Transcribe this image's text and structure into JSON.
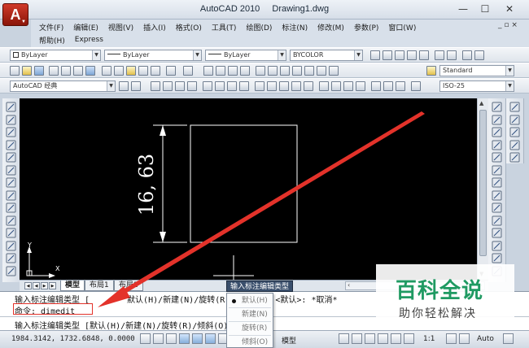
{
  "title": {
    "app": "AutoCAD 2010",
    "document": "Drawing1.dwg"
  },
  "app_button_label": "A",
  "window_controls": {
    "minimize": "—",
    "maximize": "☐",
    "close": "✕"
  },
  "menu": {
    "row1": [
      "文件(F)",
      "编辑(E)",
      "视图(V)",
      "插入(I)",
      "格式(O)",
      "工具(T)",
      "绘图(D)",
      "标注(N)",
      "修改(M)",
      "参数(P)",
      "窗口(W)"
    ],
    "row2": [
      "帮助(H)",
      "Express"
    ],
    "doc_controls": "_ ▫ ×"
  },
  "toolbar": {
    "layer_combo": "ByLayer",
    "linetype_combo": "ByLayer",
    "lineweight_combo": "ByLayer",
    "color_combo": "BYCOLOR",
    "text_style": "Standard",
    "workspace": "AutoCAD 经典",
    "dim_style": "ISO-25"
  },
  "drawing": {
    "dimension_text": "16, 63",
    "ucs_y": "Y",
    "ucs_x": "X"
  },
  "layout_tabs": [
    "模型",
    "布局1",
    "布局2"
  ],
  "command": {
    "line1_left": "输入标注编辑类型 [",
    "line1_right": "默认(H)/新建(N)/旋转(R)/倾斜(O)] <默认>: *取消*",
    "prompt": "命令: dimedit",
    "line3": "输入标注编辑类型 [默认(H)/新建(N)/旋转(R)/倾斜(O)] <默认>:"
  },
  "tooltip": "输入标注编辑类型",
  "popup_menu": [
    {
      "label": "默认(H)",
      "selected": true
    },
    {
      "label": "新建(N)",
      "selected": false
    },
    {
      "label": "旋转(R)",
      "selected": false
    },
    {
      "label": "倾斜(O)",
      "selected": false
    }
  ],
  "status": {
    "coords": "1984.3142, 1732.6848, 0.0000",
    "model_label": "模型",
    "scale": "1:1",
    "auto": "Auto"
  },
  "watermark": {
    "main": "百科全说",
    "sub": "助你轻松解决"
  },
  "colors": {
    "annotation_arrow": "#e3322a",
    "watermark_green": "#1f9a62",
    "canvas": "#000000"
  }
}
